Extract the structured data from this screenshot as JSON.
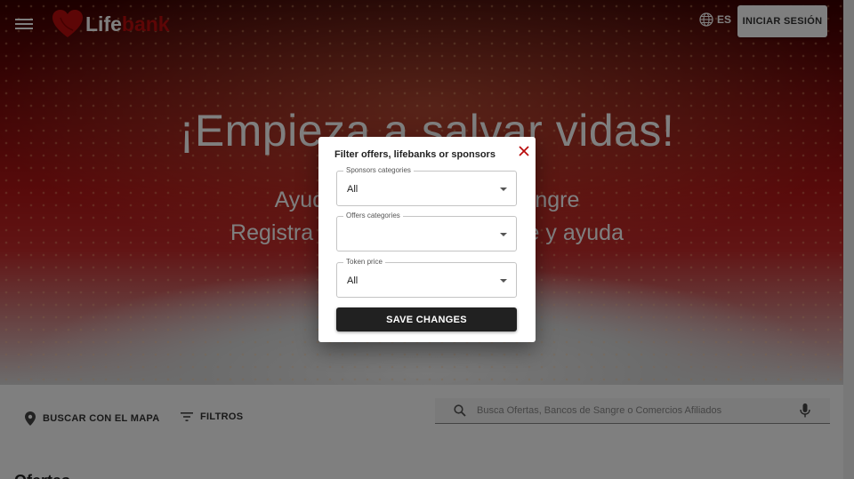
{
  "header": {
    "logo_text_part1": "Life",
    "logo_text_part2": "bank",
    "language_label": "ES",
    "login_button": "INICIAR SESIÓN"
  },
  "hero": {
    "title": "¡Empieza a salvar vidas!",
    "subtitle_line1": "Ayuda a los Bancos de Sangre",
    "subtitle_line2": "Registra tu donación de sangre y ayuda"
  },
  "toolbar": {
    "map_label": "BUSCAR CON EL MAPA",
    "filters_label": "FILTROS",
    "search_placeholder": "Busca Ofertas, Bancos de Sangre o Comercios Afiliados"
  },
  "main": {
    "offers_heading": "Ofertas"
  },
  "filter_dialog": {
    "title": "Filter offers, lifebanks or sponsors",
    "fields": [
      {
        "label": "Sponsors categories",
        "value": "All"
      },
      {
        "label": "Offers categories",
        "value": ""
      },
      {
        "label": "Token price",
        "value": "All"
      }
    ],
    "save_button": "SAVE CHANGES"
  },
  "colors": {
    "brand_red": "#ba0d0d",
    "dark_button": "#212121",
    "hero_red": "#b11616"
  },
  "icons": [
    "menu-icon",
    "heart-logo-icon",
    "globe-icon",
    "location-pin-icon",
    "filter-icon",
    "search-icon",
    "microphone-icon",
    "close-icon",
    "dropdown-caret-icon"
  ]
}
